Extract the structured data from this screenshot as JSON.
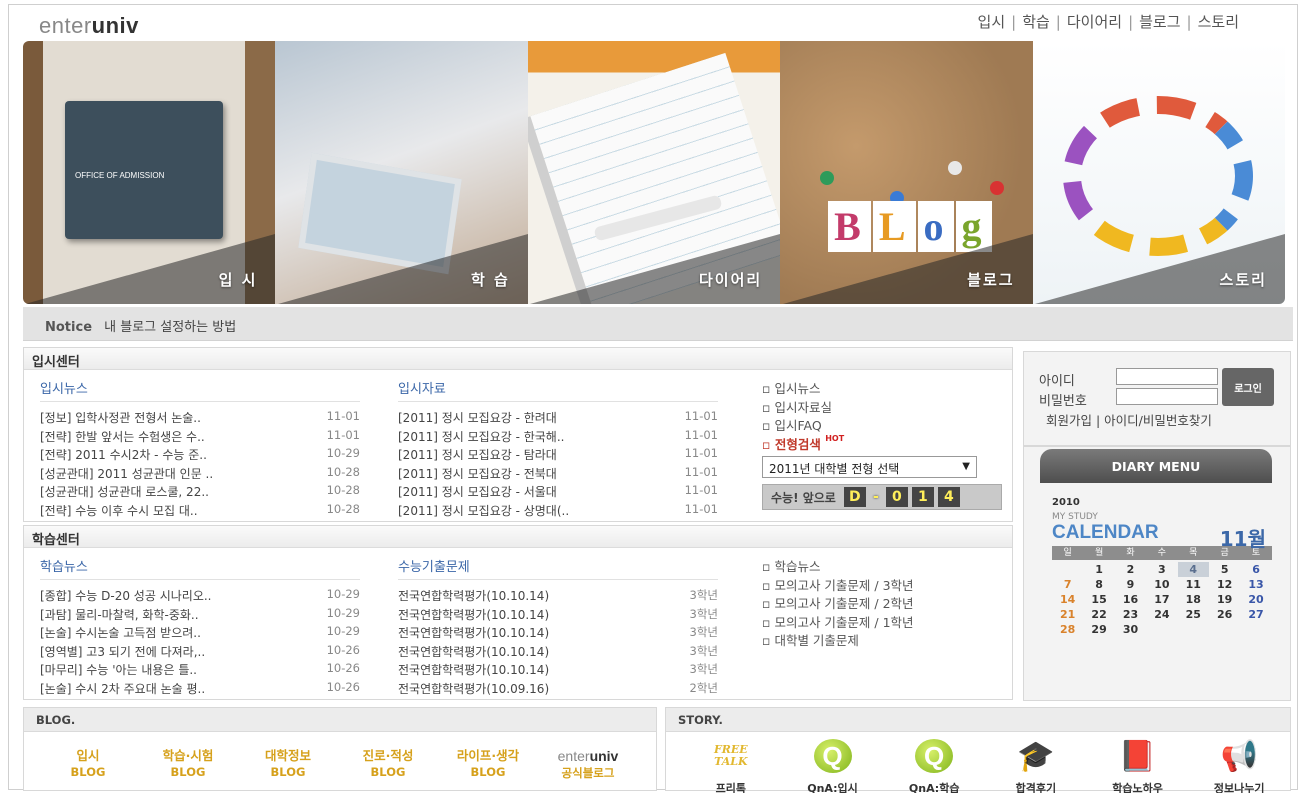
{
  "logo": {
    "light": "enter",
    "bold": "univ"
  },
  "topnav": [
    "입시",
    "학습",
    "다이어리",
    "블로그",
    "스토리"
  ],
  "hero": {
    "panels": [
      "입 시",
      "학 습",
      "다이어리",
      "블로그",
      "스토리"
    ],
    "office_sign": "OFFICE OF ADMISSION",
    "blog_letters": [
      "B",
      "L",
      "o",
      "g"
    ]
  },
  "notice": {
    "label": "Notice",
    "text": "내 블로그 설정하는 방법"
  },
  "admission": {
    "title": "입시센터",
    "news": {
      "title": "입시뉴스",
      "items": [
        {
          "text": "[정보] 입학사정관 전형서 논술..",
          "date": "11-01"
        },
        {
          "text": "[전략] 한발 앞서는 수험생은 수..",
          "date": "11-01"
        },
        {
          "text": "[전략] 2011 수시2차 - 수능 준..",
          "date": "10-29"
        },
        {
          "text": "[성균관대] 2011 성균관대 인문 ..",
          "date": "10-28"
        },
        {
          "text": "[성균관대] 성균관대 로스쿨, 22..",
          "date": "10-28"
        },
        {
          "text": "[전략] 수능 이후 수시 모집 대..",
          "date": "10-28"
        }
      ]
    },
    "materials": {
      "title": "입시자료",
      "items": [
        {
          "text": "[2011] 정시 모집요강 - 한려대",
          "date": "11-01"
        },
        {
          "text": "[2011] 정시 모집요강 - 한국해..",
          "date": "11-01"
        },
        {
          "text": "[2011] 정시 모집요강 - 탐라대",
          "date": "11-01"
        },
        {
          "text": "[2011] 정시 모집요강 - 전북대",
          "date": "11-01"
        },
        {
          "text": "[2011] 정시 모집요강 - 서울대",
          "date": "11-01"
        },
        {
          "text": "[2011] 정시 모집요강 - 상명대(..",
          "date": "11-01"
        }
      ]
    },
    "links": [
      "입시뉴스",
      "입시자료실",
      "입시FAQ",
      "전형검색"
    ],
    "hot": "HOT",
    "select": "2011년 대학별 전형 선택",
    "dday": {
      "label": "수능! 앞으로",
      "digits": [
        "D",
        "-",
        "0",
        "1",
        "4"
      ]
    }
  },
  "study": {
    "title": "학습센터",
    "news": {
      "title": "학습뉴스",
      "items": [
        {
          "text": "[종합] 수능 D-20 성공 시나리오..",
          "date": "10-29"
        },
        {
          "text": "[과탐] 물리-마찰력, 화학-중화..",
          "date": "10-29"
        },
        {
          "text": "[논술] 수시논술 고득점 받으려..",
          "date": "10-29"
        },
        {
          "text": "[영역별] 고3 되기 전에 다져라,..",
          "date": "10-26"
        },
        {
          "text": "[마무리] 수능 '아는 내용은 틀..",
          "date": "10-26"
        },
        {
          "text": "[논술] 수시 2차 주요대 논술 평..",
          "date": "10-26"
        }
      ]
    },
    "exams": {
      "title": "수능기출문제",
      "items": [
        {
          "text": "전국연합학력평가(10.10.14)",
          "date": "3학년"
        },
        {
          "text": "전국연합학력평가(10.10.14)",
          "date": "3학년"
        },
        {
          "text": "전국연합학력평가(10.10.14)",
          "date": "3학년"
        },
        {
          "text": "전국연합학력평가(10.10.14)",
          "date": "3학년"
        },
        {
          "text": "전국연합학력평가(10.10.14)",
          "date": "3학년"
        },
        {
          "text": "전국연합학력평가(10.09.16)",
          "date": "2학년"
        }
      ]
    },
    "links": [
      "학습뉴스",
      "모의고사 기출문제 / 3학년",
      "모의고사 기출문제 / 2학년",
      "모의고사 기출문제 / 1학년",
      "대학별 기출문제"
    ]
  },
  "login": {
    "id_label": "아이디",
    "pw_label": "비밀번호",
    "button": "로그인",
    "join": "회원가입 | 아이디/비밀번호찾기"
  },
  "diary": {
    "button": "DIARY MENU",
    "year": "2010",
    "my_study": "MY STUDY",
    "calendar": "CALENDAR",
    "month": "11월",
    "weekdays": [
      "일",
      "월",
      "화",
      "수",
      "목",
      "금",
      "토"
    ],
    "today": 4,
    "days": [
      "",
      "1",
      "2",
      "3",
      "4",
      "5",
      "6",
      "7",
      "8",
      "9",
      "10",
      "11",
      "12",
      "13",
      "14",
      "15",
      "16",
      "17",
      "18",
      "19",
      "20",
      "21",
      "22",
      "23",
      "24",
      "25",
      "26",
      "27",
      "28",
      "29",
      "30"
    ]
  },
  "blog": {
    "title": "BLOG.",
    "items": [
      {
        "top": "입시",
        "bottom": "BLOG"
      },
      {
        "top": "학습·시험",
        "bottom": "BLOG"
      },
      {
        "top": "대학정보",
        "bottom": "BLOG"
      },
      {
        "top": "진로·적성",
        "bottom": "BLOG"
      },
      {
        "top": "라이프·생각",
        "bottom": "BLOG"
      }
    ],
    "official": {
      "logo_light": "enter",
      "logo_bold": "univ",
      "label": "공식블로그"
    }
  },
  "story": {
    "title": "STORY.",
    "items": [
      {
        "icon": "free-talk-icon",
        "art": "FREE TALK",
        "label": "프리톡"
      },
      {
        "icon": "q-icon",
        "art": "Q",
        "label": "QnA:입시"
      },
      {
        "icon": "q-icon",
        "art": "Q",
        "label": "QnA:학습"
      },
      {
        "icon": "graduation-cap-icon",
        "art": "🎓",
        "label": "합격후기"
      },
      {
        "icon": "book-icon",
        "art": "📕",
        "label": "학습노하우"
      },
      {
        "icon": "megaphone-icon",
        "art": "📢",
        "label": "정보나누기"
      }
    ]
  },
  "colors": {
    "link_blue": "#3b67a8",
    "accent_gold": "#d6a11c",
    "hot_red": "#d12020"
  }
}
